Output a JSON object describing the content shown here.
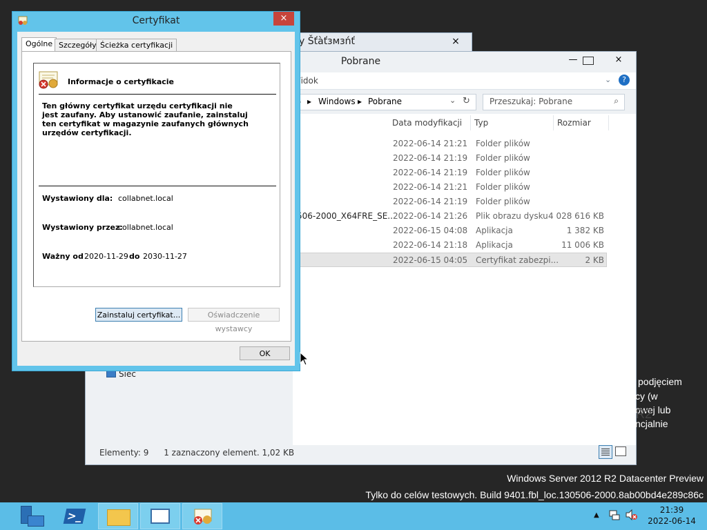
{
  "desktop": {
    "watermark_line1": "Windows Server 2012 R2 Datacenter Preview",
    "watermark_line2": "Tylko do celów testowych. Build 9401.fbl_loc.130506-2000.8ab00bd4e289c86c",
    "side_text": [
      "podjęciem",
      "cy (w",
      "owej lub",
      "ncjalnie"
    ],
    "side_fragment": "R2"
  },
  "back_window": {
    "title": "y Šťàťзмзńť",
    "close_label": "×"
  },
  "explorer": {
    "title": "Pobrane",
    "minimize": "—",
    "maximize": "□",
    "close": "×",
    "ribbon_view": "Widok",
    "help": "?",
    "address": {
      "crumb1": "Windows",
      "crumb2": "Pobrane"
    },
    "search_placeholder": "Przeszukaj: Pobrane",
    "columns": {
      "date": "Data modyfikacji",
      "type": "Typ",
      "size": "Rozmiar"
    },
    "rows": [
      {
        "name": "",
        "date": "2022-06-14 21:21",
        "type": "Folder plików",
        "size": ""
      },
      {
        "name": "",
        "date": "2022-06-14 21:19",
        "type": "Folder plików",
        "size": ""
      },
      {
        "name": "",
        "date": "2022-06-14 21:19",
        "type": "Folder plików",
        "size": ""
      },
      {
        "name": "",
        "date": "2022-06-14 21:21",
        "type": "Folder plików",
        "size": ""
      },
      {
        "name": "",
        "date": "2022-06-14 21:19",
        "type": "Folder plików",
        "size": ""
      },
      {
        "name": "506-2000_X64FRE_SE...",
        "date": "2022-06-14 21:26",
        "type": "Plik obrazu dysku",
        "size": "4 028 616 KB"
      },
      {
        "name": "",
        "date": "2022-06-15 04:08",
        "type": "Aplikacja",
        "size": "1 382 KB"
      },
      {
        "name": "",
        "date": "2022-06-14 21:18",
        "type": "Aplikacja",
        "size": "11 006 KB"
      },
      {
        "name": "",
        "date": "2022-06-15 04:05",
        "type": "Certyfikat zabezpi...",
        "size": "2 KB"
      }
    ],
    "nav_network": "Sieć",
    "status_count": "Elementy: 9",
    "status_selected": "1 zaznaczony element. 1,02 KB"
  },
  "cert": {
    "title": "Certyfikat",
    "close": "×",
    "tabs": [
      "Ogólne",
      "Szczegóły",
      "Ścieżka certyfikacji"
    ],
    "heading": "Informacje o certyfikacie",
    "warning": "Ten główny certyfikat urzędu certyfikacji nie jest zaufany. Aby ustanowić zaufanie, zainstaluj ten certyfikat w magazynie zaufanych głównych urzędów certyfikacji.",
    "issued_to_label": "Wystawiony dla:",
    "issued_to": "collabnet.local",
    "issued_by_label": "Wystawiony przez:",
    "issued_by": "collabnet.local",
    "valid_from_label": "Ważny od",
    "valid_from": "2020-11-29",
    "valid_to_label": "do",
    "valid_to": "2030-11-27",
    "install_button": "Zainstaluj certyfikat...",
    "issuer_statement_button": "Oświadczenie wystawcy",
    "ok_button": "OK"
  },
  "taskbar": {
    "time": "21:39",
    "date": "2022-06-14",
    "items": [
      "server-manager-icon",
      "powershell-icon",
      "file-explorer-icon",
      "app-window-icon",
      "certificate-icon"
    ]
  },
  "colors": {
    "taskbar": "#5bbde7",
    "dialog_frame": "#62c4ea",
    "close_red": "#c7443b",
    "desktop": "#262626"
  }
}
